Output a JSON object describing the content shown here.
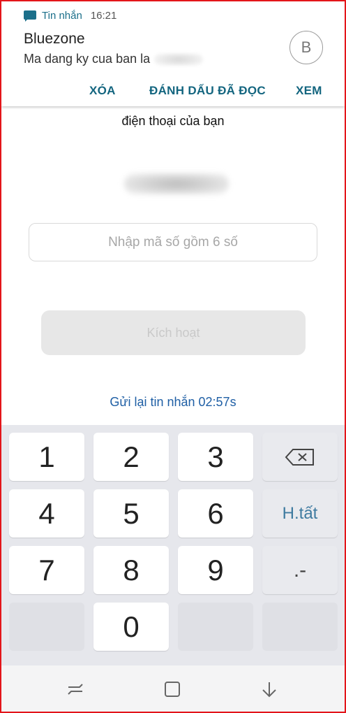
{
  "notification": {
    "app_name": "Tin nhắn",
    "time": "16:21",
    "sender": "Bluezone",
    "message": "Ma dang ky cua ban la",
    "avatar_letter": "B",
    "actions": {
      "delete": "XÓA",
      "mark_read": "ĐÁNH DẤU ĐÃ ĐỌC",
      "view": "XEM"
    },
    "accent_color": "#13657f"
  },
  "activation": {
    "subtitle": "điện thoại của bạn",
    "otp_placeholder": "Nhập mã số gồm 6 số",
    "otp_value": "",
    "activate_label": "Kích hoạt",
    "resend_label": "Gửi lại tin nhắn 02:57s",
    "link_color": "#1f5fa5"
  },
  "keyboard": {
    "keys": [
      "1",
      "2",
      "3",
      "4",
      "5",
      "6",
      "7",
      "8",
      "9",
      "0"
    ],
    "done_label": "H.tất",
    "symbol_label": ".-",
    "backspace_icon": "backspace-icon"
  },
  "nav": {
    "icons": [
      "recent-apps-icon",
      "home-icon",
      "back-icon"
    ]
  }
}
